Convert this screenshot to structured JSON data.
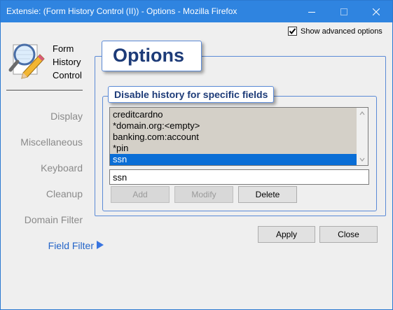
{
  "window": {
    "title": "Extensie: (Form History Control (II)) - Options - Mozilla Firefox"
  },
  "advanced": {
    "label": "Show advanced options",
    "checked": true
  },
  "brand": {
    "line1": "Form",
    "line2": "History",
    "line3": "Control",
    "logo_icon": "magnifier-pencil-icon"
  },
  "sidebar": {
    "items": [
      {
        "label": "Display"
      },
      {
        "label": "Miscellaneous"
      },
      {
        "label": "Keyboard"
      },
      {
        "label": "Cleanup"
      },
      {
        "label": "Domain Filter"
      },
      {
        "label": "Field Filter",
        "active": true
      }
    ]
  },
  "main": {
    "title": "Options",
    "group": {
      "title": "Disable history for specific fields",
      "list": [
        "creditcardno",
        "*domain.org:<empty>",
        "banking.com:account",
        "*pin",
        "ssn"
      ],
      "selected_index": 4,
      "input_value": "ssn",
      "buttons": {
        "add": "Add",
        "modify": "Modify",
        "delete": "Delete"
      }
    }
  },
  "footer": {
    "apply": "Apply",
    "close": "Close"
  },
  "colors": {
    "titlebar": "#2f84e0",
    "accent": "#2565c8",
    "selection": "#0a6ed6",
    "heading": "#1d3b78"
  }
}
